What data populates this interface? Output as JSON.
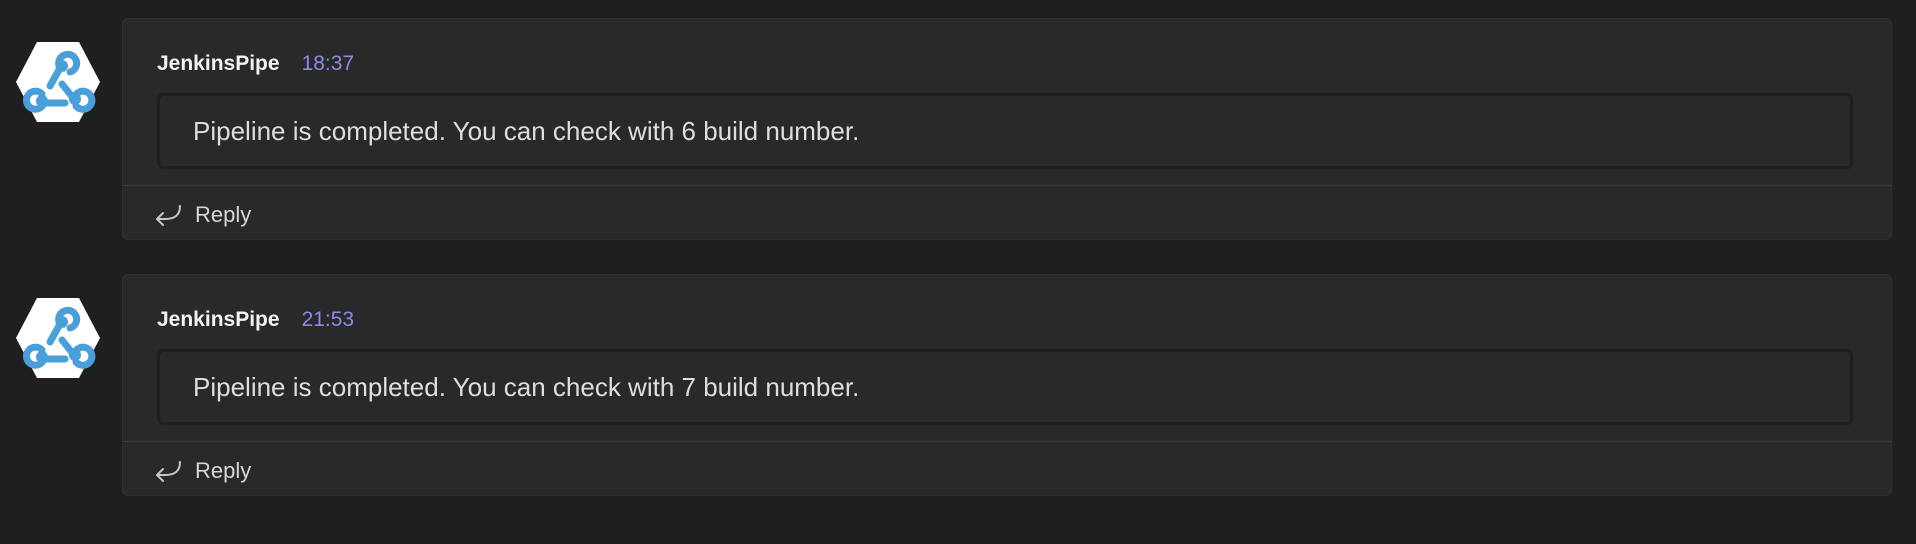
{
  "messages": [
    {
      "author": "JenkinsPipe",
      "time": "18:37",
      "text": "Pipeline is completed. You can check with 6 build number.",
      "reply_label": "Reply",
      "avatar_icon": "webhook-icon"
    },
    {
      "author": "JenkinsPipe",
      "time": "21:53",
      "text": "Pipeline is completed. You can check with 7 build number.",
      "reply_label": "Reply",
      "avatar_icon": "webhook-icon"
    }
  ],
  "colors": {
    "background": "#1f1f1f",
    "card": "#292929",
    "timestamp": "#8a8ce6",
    "avatar_accent": "#4a9fd8"
  }
}
